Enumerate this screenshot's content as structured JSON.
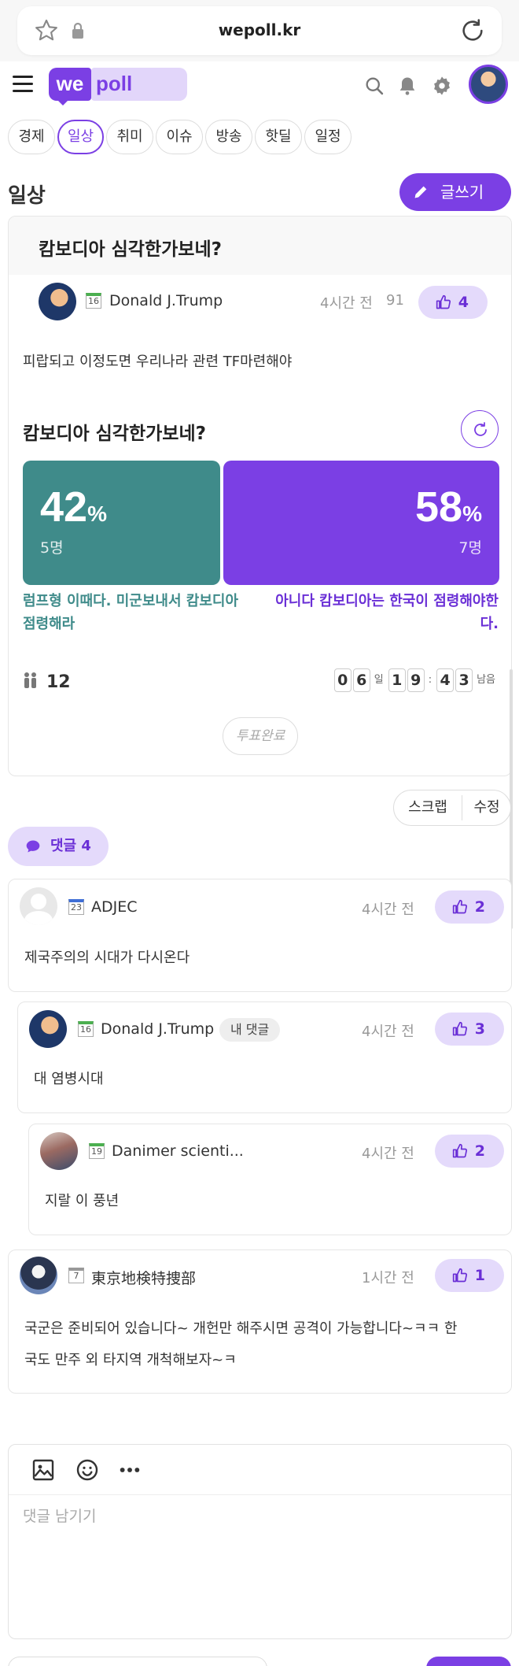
{
  "browser": {
    "url": "wepoll.kr"
  },
  "header": {
    "logo_we": "we",
    "logo_poll": "poll"
  },
  "tabs": [
    {
      "label": "경제"
    },
    {
      "label": "일상",
      "active": true
    },
    {
      "label": "취미"
    },
    {
      "label": "이슈"
    },
    {
      "label": "방송"
    },
    {
      "label": "핫딜"
    },
    {
      "label": "일정"
    }
  ],
  "section": {
    "title": "일상",
    "write_label": "글쓰기"
  },
  "post": {
    "title": "캄보디아 심각한가보네?",
    "author": "Donald J.Trump",
    "level": "16",
    "time": "4시간 전",
    "views": "91",
    "likes": "4",
    "body": "피랍되고 이정도면 우리나라 관련 TF마련해야",
    "poll": {
      "title": "캄보디아 심각한가보네?",
      "option_a": {
        "percent": "42",
        "percent_sign": "%",
        "count": "5명",
        "label": "럼프형 이때다. 미군보내서 캄보디아 점령해라",
        "color": "#3f8b8a"
      },
      "option_b": {
        "percent": "58",
        "percent_sign": "%",
        "count": "7명",
        "label": "아니다 캄보디아는 한국이 점령해야한다.",
        "color": "#7b3fe4"
      },
      "participants": "12",
      "countdown": {
        "d1": "0",
        "d2": "6",
        "day_unit": "일",
        "h1": "1",
        "h2": "9",
        "sep": ":",
        "m1": "4",
        "m2": "3",
        "remain": "남음"
      },
      "status": "투표완료"
    },
    "actions": {
      "scrap": "스크랩",
      "edit": "수정"
    }
  },
  "comments_pill": {
    "label": "댓글",
    "count": "4"
  },
  "comments": [
    {
      "author": "ADJEC",
      "level": "23",
      "time": "4시간 전",
      "likes": "2",
      "body": "제국주의의 시대가 다시온다"
    },
    {
      "author": "Donald J.Trump",
      "level": "16",
      "tag": "내 댓글",
      "time": "4시간 전",
      "likes": "3",
      "body": "대 염병시대"
    },
    {
      "author": "Danimer scienti...",
      "level": "19",
      "time": "4시간 전",
      "likes": "2",
      "body": "지랄 이 풍년"
    },
    {
      "author": "東京地検特捜部",
      "level": "7",
      "time": "1시간 전",
      "likes": "1",
      "body_line1": "국군은 준비되어 있습니다~ 개헌만 해주시면 공격이 가능합니다~ㅋㅋ 한",
      "body_line2": "국도 만주 외 타지역 개척해보자~ㅋ"
    }
  ],
  "editor": {
    "placeholder": "댓글 남기기"
  },
  "colors": {
    "accent": "#7b3fe4",
    "accent_light": "#e4dafb",
    "teal": "#3f8b8a"
  }
}
